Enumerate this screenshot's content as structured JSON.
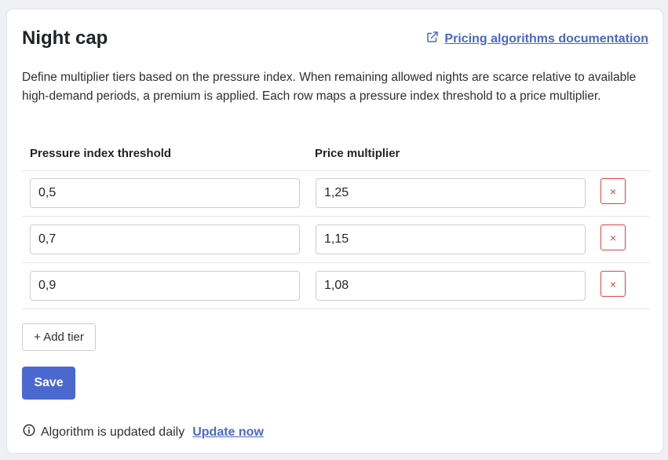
{
  "header": {
    "title": "Night cap",
    "doc_link": "Pricing algorithms documentation"
  },
  "description": "Define multiplier tiers based on the pressure index. When remaining allowed nights are scarce relative to available high-demand periods, a premium is applied. Each row maps a pressure index threshold to a price multiplier.",
  "table": {
    "columns": [
      "Pressure index threshold",
      "Price multiplier"
    ],
    "rows": [
      {
        "threshold": "0,5",
        "multiplier": "1,25"
      },
      {
        "threshold": "0,7",
        "multiplier": "1,15"
      },
      {
        "threshold": "0,9",
        "multiplier": "1,08"
      }
    ],
    "delete_glyph": "×"
  },
  "buttons": {
    "add_tier": "+ Add tier",
    "save": "Save"
  },
  "footer": {
    "status": "Algorithm is updated daily",
    "update_link": "Update now"
  },
  "colors": {
    "accent": "#4a68d0",
    "link": "#4a68c8",
    "danger": "#d9453d"
  },
  "icons": {
    "doc_link": "external-link-icon",
    "footer": "info-icon"
  }
}
